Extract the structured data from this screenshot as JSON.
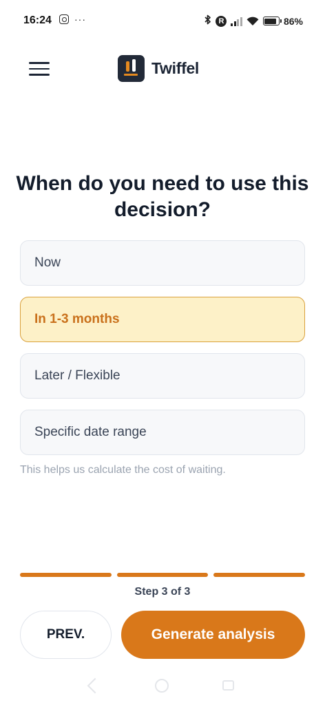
{
  "status_bar": {
    "time": "16:24",
    "dots": "···",
    "carrier_badge": "R",
    "battery_percent": "86%",
    "battery_level": 0.86
  },
  "header": {
    "brand": "Twiffel"
  },
  "question": "When do you need to use this decision?",
  "options": [
    {
      "label": "Now",
      "selected": false
    },
    {
      "label": "In 1-3 months",
      "selected": true
    },
    {
      "label": "Later / Flexible",
      "selected": false
    },
    {
      "label": "Specific date range",
      "selected": false
    }
  ],
  "helper_text": "This helps us calculate the cost of waiting.",
  "progress": {
    "step_label": "Step 3 of 3",
    "current_step": 3,
    "total_steps": 3
  },
  "buttons": {
    "prev_label": "PREV.",
    "generate_label": "Generate analysis"
  },
  "colors": {
    "accent": "#d9781a",
    "selected_bg": "#fdf1c8",
    "selected_text": "#c9701b"
  }
}
